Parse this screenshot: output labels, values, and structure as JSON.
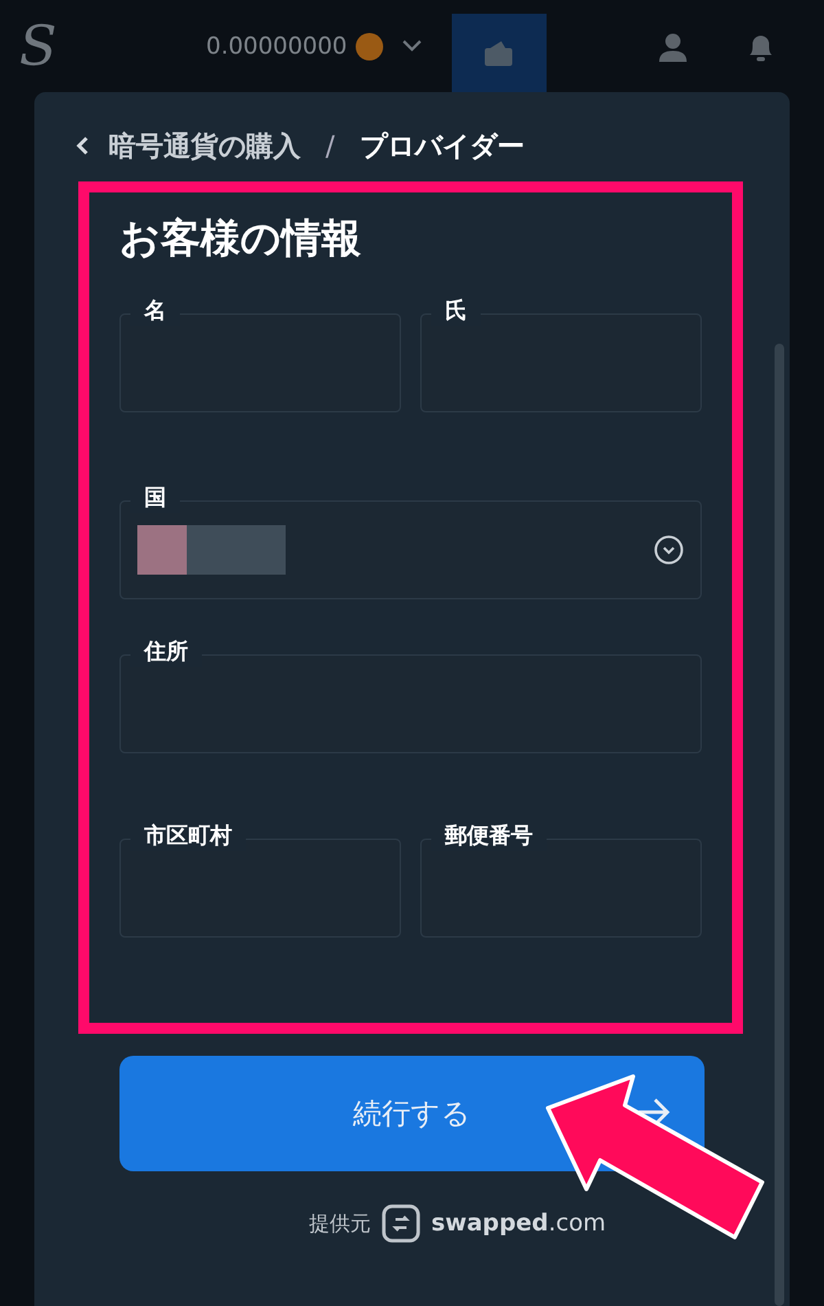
{
  "header": {
    "logo": "S",
    "balance": "0.00000000"
  },
  "breadcrumb": {
    "parent": "暗号通貨の購入",
    "separator": "/",
    "current": "プロバイダー"
  },
  "form": {
    "title": "お客様の情報",
    "rows": [
      [
        {
          "kind": "text",
          "label": "名"
        },
        {
          "kind": "text",
          "label": "氏"
        }
      ],
      [
        {
          "kind": "select",
          "label": "国",
          "value_redacted": true
        }
      ],
      [
        {
          "kind": "text",
          "label": "住所"
        }
      ],
      [
        {
          "kind": "text",
          "label": "市区町村"
        },
        {
          "kind": "text",
          "label": "郵便番号"
        }
      ]
    ]
  },
  "continue_button": {
    "label": "続行する"
  },
  "provider": {
    "label": "提供元",
    "brand": "**swapped**.com"
  }
}
